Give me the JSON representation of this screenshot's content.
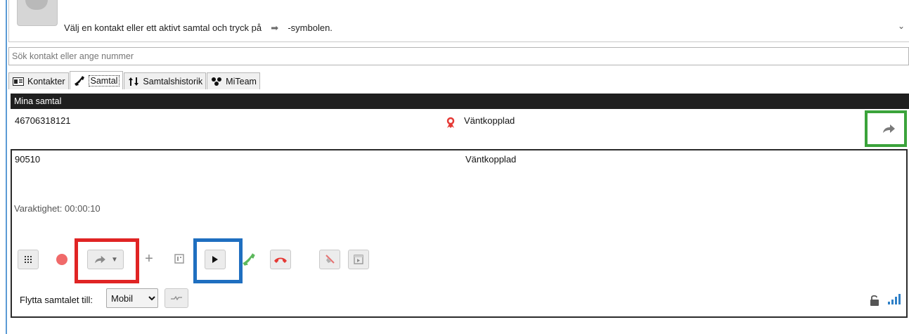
{
  "info_panel": {
    "message_before": "Välj en kontakt eller ett aktivt samtal och tryck på",
    "arrow_glyph": "➡",
    "message_after": "-symbolen.",
    "chevron": "⌄"
  },
  "search": {
    "placeholder": "Sök kontakt eller ange nummer"
  },
  "tabs": [
    {
      "label": "Kontakter",
      "icon": "contact-card-icon"
    },
    {
      "label": "Samtal",
      "icon": "phone-handset-icon",
      "active": true
    },
    {
      "label": "Samtalshistorik",
      "icon": "history-arrows-icon"
    },
    {
      "label": "MiTeam",
      "icon": "team-icon"
    }
  ],
  "calls": {
    "header": "Mina samtal",
    "items": [
      {
        "number": "46706318121",
        "status": "Väntkopplad",
        "status_icon": "hold-person-icon",
        "action_icon": "transfer-arrow-icon"
      },
      {
        "number": "90510",
        "status": "Väntkopplad",
        "duration_label": "Varaktighet:",
        "duration": "00:00:10"
      }
    ]
  },
  "controls": {
    "buttons": [
      "dialpad-icon",
      "record-icon",
      "transfer-icon",
      "dropdown-icon",
      "add-icon",
      "park-icon",
      "play-resume-icon",
      "answer-icon",
      "hangup-icon",
      "mute-icon",
      "screen-icon"
    ]
  },
  "move_call": {
    "label": "Flytta samtalet till:",
    "selected": "Mobil",
    "options": [
      "Mobil"
    ]
  },
  "colors": {
    "header_bg": "#1f1f1f",
    "highlight_green": "#3ba33b",
    "highlight_red": "#e02424",
    "highlight_blue": "#1f6fc0",
    "answer_green": "#4caf50",
    "hangup_red": "#e53935"
  }
}
